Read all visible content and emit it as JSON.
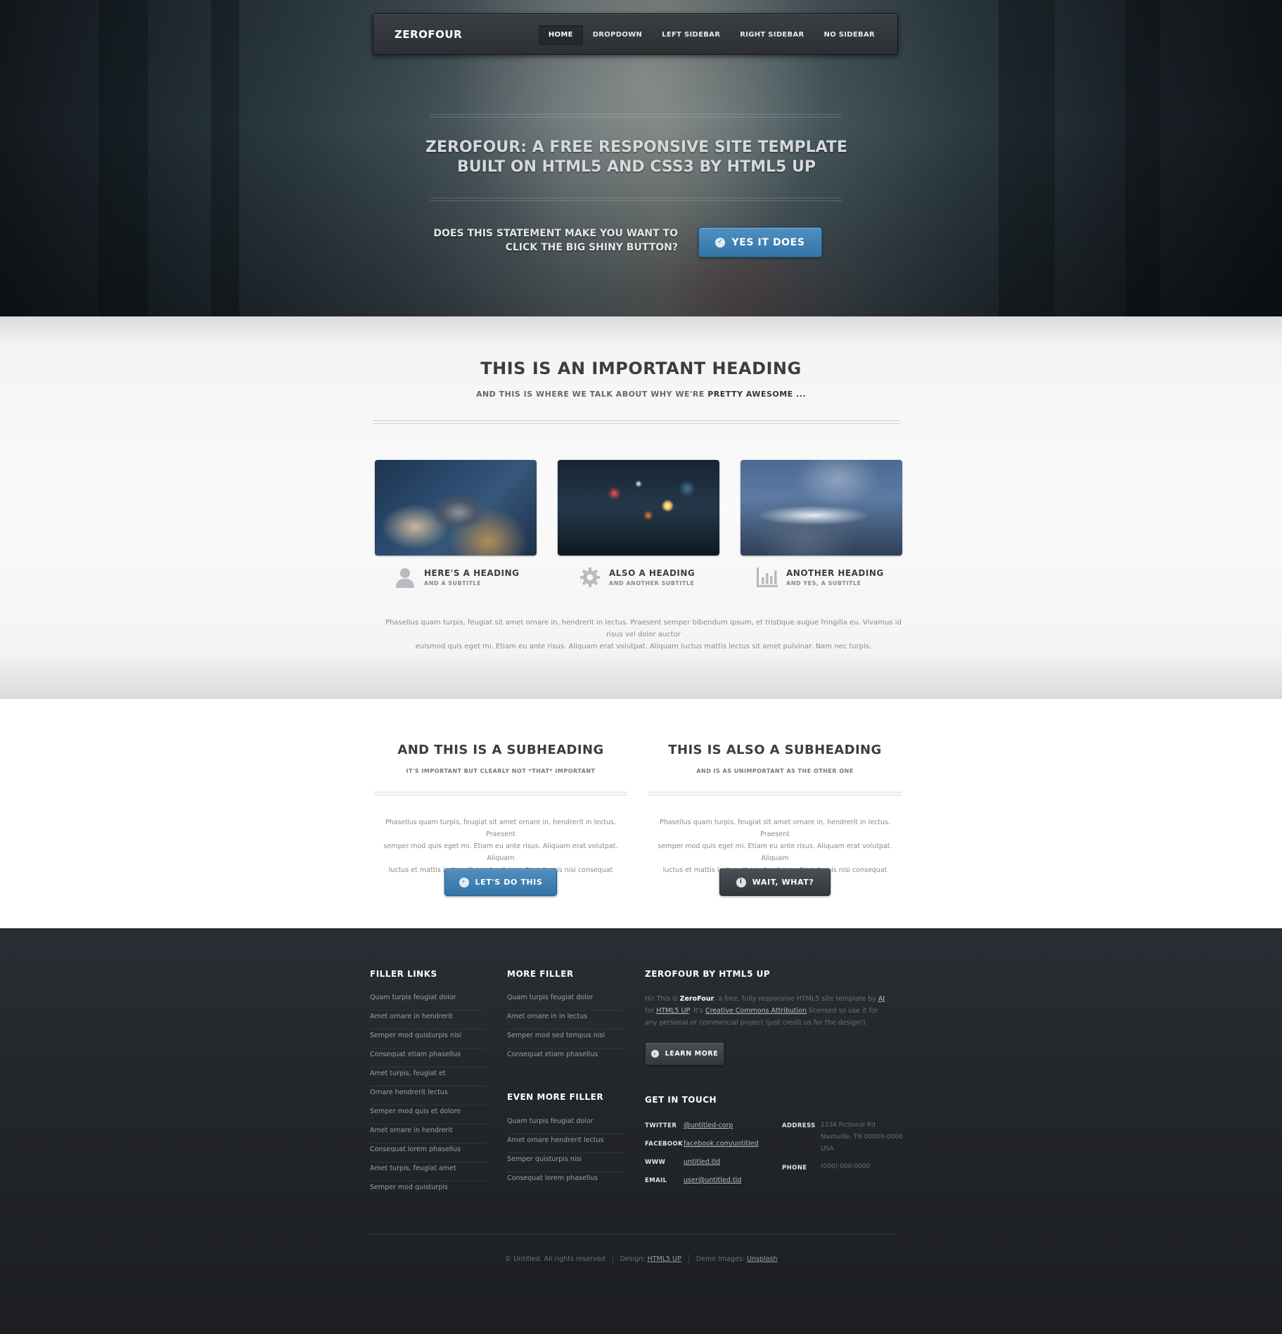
{
  "header": {
    "logo": "ZEROFOUR",
    "nav": [
      "HOME",
      "DROPDOWN",
      "LEFT SIDEBAR",
      "RIGHT SIDEBAR",
      "NO SIDEBAR"
    ],
    "active_nav": "HOME"
  },
  "hero": {
    "title_line1": "ZEROFOUR: A FREE RESPONSIVE SITE TEMPLATE",
    "title_line2": "BUILT ON HTML5 AND CSS3 BY HTML5 UP",
    "cta_line1": "DOES THIS STATEMENT MAKE YOU WANT TO",
    "cta_line2": "CLICK THE BIG SHINY BUTTON?",
    "button": "YES IT DOES"
  },
  "main": {
    "heading": "THIS IS AN IMPORTANT HEADING",
    "sub_prefix": "AND THIS IS WHERE WE TALK ABOUT WHY WE'RE",
    "sub_strong": "PRETTY AWESOME ...",
    "features": [
      {
        "icon": "user-icon",
        "title": "HERE'S A HEADING",
        "subtitle": "AND A SUBTITLE"
      },
      {
        "icon": "gear-icon",
        "title": "ALSO A HEADING",
        "subtitle": "AND ANOTHER SUBTITLE"
      },
      {
        "icon": "bar-chart-icon",
        "title": "ANOTHER HEADING",
        "subtitle": "AND YES, A SUBTITLE"
      }
    ],
    "text_line1": "Phasellus quam turpis, feugiat sit amet ornare in, hendrerit in lectus. Praesent semper bibendum ipsum, et tristique augue fringilla eu. Vivamus id risus vel dolor auctor",
    "text_line2": "euismod quis eget mi. Etiam eu ante risus. Aliquam erat volutpat. Aliquam luctus mattis lectus sit amet pulvinar. Nam nec turpis."
  },
  "subsections": [
    {
      "heading": "AND THIS IS A SUBHEADING",
      "subtitle": "IT'S IMPORTANT BUT CLEARLY NOT *THAT* IMPORTANT",
      "text_line1": "Phasellus quam turpis, feugiat sit amet ornare in, hendrerit in lectus. Praesent",
      "text_line2": "semper mod quis eget mi. Etiam eu ante risus. Aliquam erat volutpat. Aliquam",
      "text_line3": "luctus et mattis lectus sit amet pulvinar. Nam turpis nisi consequat etiam.",
      "button": "LET'S DO THIS"
    },
    {
      "heading": "THIS IS ALSO A SUBHEADING",
      "subtitle": "AND IS AS UNIMPORTANT AS THE OTHER ONE",
      "text_line1": "Phasellus quam turpis, feugiat sit amet ornare in, hendrerit in lectus. Praesent",
      "text_line2": "semper mod quis eget mi. Etiam eu ante risus. Aliquam erat volutpat. Aliquam",
      "text_line3": "luctus et mattis lectus sit amet pulvinar. Nam turpis nisi consequat etiam.",
      "button": "WAIT, WHAT?"
    }
  ],
  "footer": {
    "filler_links": {
      "title": "FILLER LINKS",
      "items": [
        "Quam turpis feugiat dolor",
        "Amet ornare in hendrerit",
        "Semper mod quisturpis nisi",
        "Consequat etiam phasellus",
        "Amet turpis, feugiat et",
        "Ornare hendrerit lectus",
        "Semper mod quis et dolore",
        "Amet ornare in hendrerit",
        "Consequat lorem phasellus",
        "Amet turpis, feugiat amet",
        "Semper mod quisturpis"
      ]
    },
    "more_filler": {
      "title": "MORE FILLER",
      "items": [
        "Quam turpis feugiat dolor",
        "Amet ornare in in lectus",
        "Semper mod sed tempus nisi",
        "Consequat etiam phasellus"
      ]
    },
    "even_more_filler": {
      "title": "EVEN MORE FILLER",
      "items": [
        "Quam turpis feugiat dolor",
        "Amet ornare hendrerit lectus",
        "Semper quisturpis nisi",
        "Consequat lorem phasellus"
      ]
    },
    "about": {
      "title": "ZEROFOUR BY HTML5 UP",
      "t1": "Hi! This is ",
      "t2": "ZeroFour",
      "t3": ", a free, fully responsive HTML5 site template by ",
      "t4": "AJ",
      "t5": " for ",
      "t6": "HTML5 UP",
      "t7": ". It's ",
      "t8": "Creative Commons Attribution",
      "t9": " licensed so use it for any personal or commercial project (just credit us for the design!).",
      "button": "LEARN MORE"
    },
    "contact": {
      "title": "GET IN TOUCH",
      "twitter_label": "TWITTER",
      "twitter": "@untitled-corp",
      "facebook_label": "FACEBOOK",
      "facebook": "facebook.com/untitled",
      "www_label": "WWW",
      "www": "untitled.tld",
      "email_label": "EMAIL",
      "email": "user@untitled.tld",
      "address_label": "ADDRESS",
      "address_line1": "1234 Fictional Rd",
      "address_line2": "Nashville, TN 00000-0000",
      "address_line3": "USA",
      "phone_label": "PHONE",
      "phone": "(000) 000-0000"
    },
    "copyright": {
      "text": "© Untitled. All rights reserved",
      "design_label": "Design:",
      "design_link": "HTML5 UP",
      "images_label": "Demo Images:",
      "images_link": "Unsplash"
    }
  }
}
